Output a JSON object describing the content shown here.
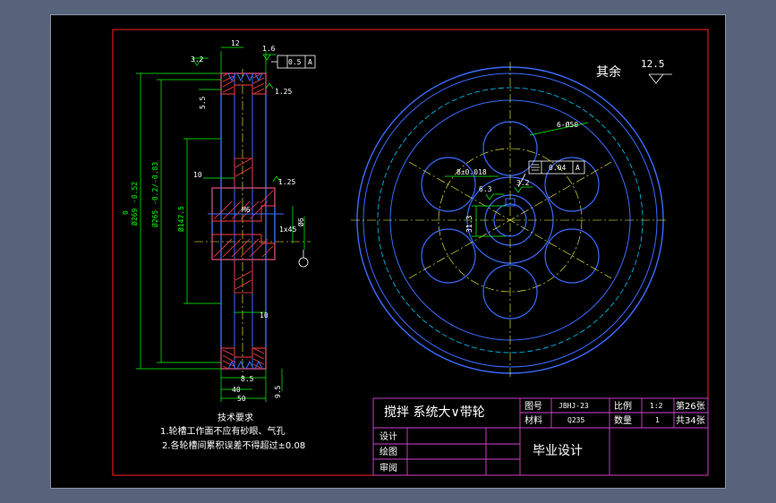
{
  "drawing": {
    "title": "搅拌系统大V带轮",
    "rough_other": "其余",
    "rough_value": "12.5",
    "dims_left": {
      "d_outer": "Ø269",
      "d_outer_tol_up": "0",
      "d_outer_tol_low": "-0.52",
      "d_pitch": "Ø265",
      "d_pitch_tol": "-0.2/-0.83",
      "d_hub": "Ø147.5",
      "w12": "12",
      "w10": "10",
      "w10b": "10",
      "w8_5": "8.5",
      "w40": "40",
      "w50": "50",
      "h9_5": "9.5",
      "h5_5": "5.5",
      "chamfer": "1x45",
      "bore": "Ø6",
      "m6": "M6",
      "r_angle": "1.6",
      "fcf_flat": "0.5",
      "fcf_ref": "A",
      "ra_1": "3.2",
      "ra_2": "1.25",
      "ra_3": "1.25"
    },
    "dims_right": {
      "holes": "6-Ø50",
      "key_width": "8±0.018",
      "key_depth": "31.3",
      "fcf_sym": "0.04",
      "fcf_ref": "A",
      "ra": "6.3",
      "ra2": "3.2"
    },
    "notes": {
      "heading": "技术要求",
      "items": [
        "1.轮槽工作面不应有砂眼、气孔",
        "2.各轮槽间累积误差不得超过±0.08"
      ]
    }
  },
  "title_block": {
    "part_name": "搅拌 系统大∨带轮",
    "drawing_no_label": "图号",
    "drawing_no": "JBHJ-23",
    "scale_label": "比例",
    "scale": "1:2",
    "sheet": "第26张",
    "material_label": "材料",
    "material": "Q235",
    "qty_label": "数量",
    "qty": "1",
    "total_sheets": "共34张",
    "design_label": "设计",
    "draw_label": "绘图",
    "review_label": "审阅",
    "project": "毕业设计"
  },
  "colors": {
    "frame": "#ff2020",
    "outline": "#3a6bff",
    "center": "#ffff44",
    "dimension": "#00ff00",
    "hatch": "#ff3b3b",
    "hidden": "#00c8ff",
    "titleblock": "#d042d0"
  }
}
